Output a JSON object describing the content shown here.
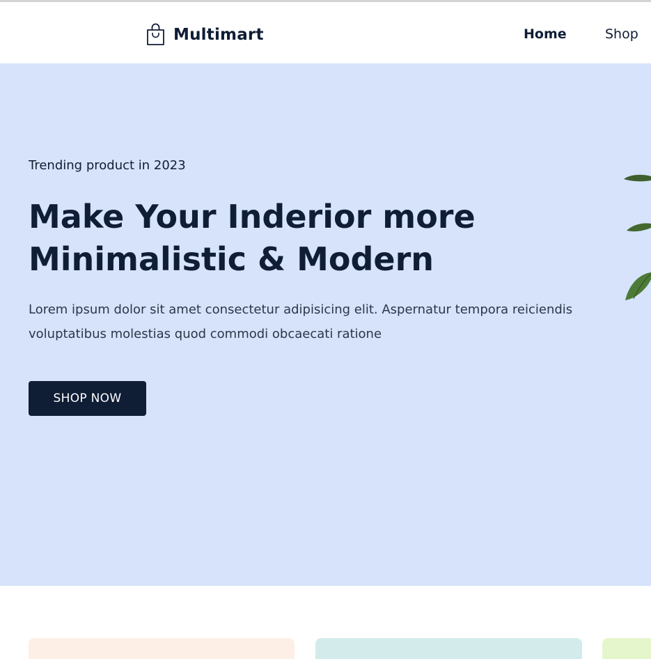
{
  "header": {
    "brand": "Multimart",
    "brand_icon": "shopping-bag-icon",
    "nav": [
      {
        "label": "Home",
        "active": true
      },
      {
        "label": "Shop",
        "active": false
      }
    ]
  },
  "hero": {
    "subtitle": "Trending product in 2023",
    "title_line1": "Make Your Inderior more",
    "title_line2": "Minimalistic & Modern",
    "description": "Lorem ipsum dolor sit amet consectetur adipisicing elit. Aspernatur tempora reiciendis voluptatibus molestias quod commodi obcaecati ratione",
    "button_label": "SHOP NOW",
    "image_icon": "plant-image"
  },
  "colors": {
    "primary": "#0f1d35",
    "hero_bg": "#d6e3fb",
    "card1_bg": "#fdefe6",
    "card2_bg": "#d3eceb",
    "card3_bg": "#e6f6cc"
  }
}
